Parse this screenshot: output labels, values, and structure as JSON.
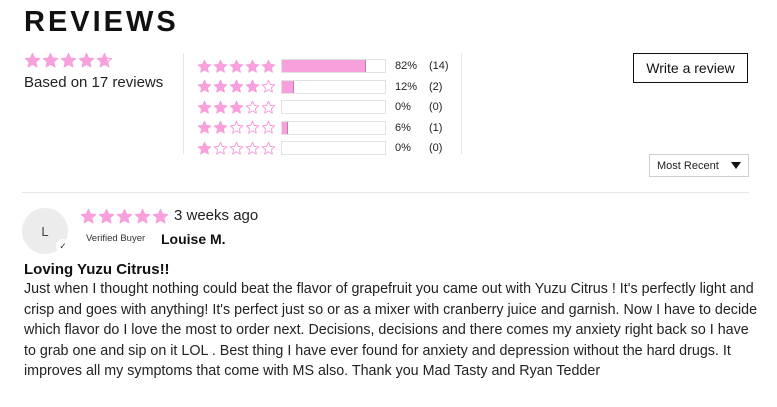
{
  "header": {
    "title": "REVIEWS"
  },
  "colors": {
    "star": "#f7a0dc",
    "bar": "#f7a0dc"
  },
  "summary": {
    "average_rating": 4.7,
    "based_on": "Based on 17 reviews"
  },
  "histogram": [
    {
      "stars": 5,
      "percent_label": "82%",
      "count_label": "(14)",
      "fraction": 0.82
    },
    {
      "stars": 4,
      "percent_label": "12%",
      "count_label": "(2)",
      "fraction": 0.12
    },
    {
      "stars": 3,
      "percent_label": "0%",
      "count_label": "(0)",
      "fraction": 0.0
    },
    {
      "stars": 2,
      "percent_label": "6%",
      "count_label": "(1)",
      "fraction": 0.06
    },
    {
      "stars": 1,
      "percent_label": "0%",
      "count_label": "(0)",
      "fraction": 0.0
    }
  ],
  "actions": {
    "write_review_label": "Write a review"
  },
  "sort": {
    "selected": "Most Recent",
    "icon": "caret-down-icon"
  },
  "reviews": [
    {
      "avatar_initial": "L",
      "rating": 5,
      "date": "3 weeks ago",
      "verified_label": "Verified Buyer",
      "author": "Louise M.",
      "title": "Loving Yuzu Citrus!!",
      "body": "Just when I thought nothing could beat the flavor of grapefruit you came out with Yuzu Citrus ! It's perfectly light and crisp and goes with anything! It's perfect just so or as a mixer with cranberry juice and garnish. Now I have to decide which flavor do I love the most to order next. Decisions, decisions and there comes my anxiety right back so I have to grab one and sip on it LOL . Best thing I have ever found for anxiety and depression without the hard drugs. It improves all my symptoms that come with MS also. Thank you Mad Tasty and Ryan Tedder"
    }
  ]
}
